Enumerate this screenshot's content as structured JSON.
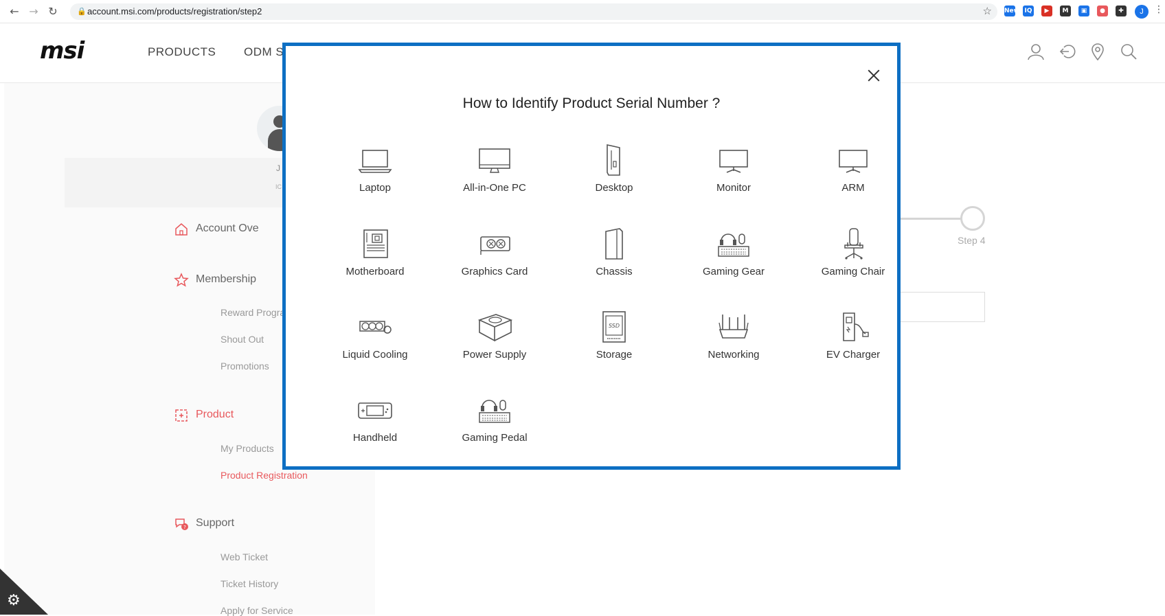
{
  "browser": {
    "url": "account.msi.com/products/registration/step2",
    "profile_initial": "J",
    "extensions": [
      {
        "name": "new-badge-extension",
        "label": "New",
        "color": "#1a73e8"
      },
      {
        "name": "iq-extension",
        "label": "IQ",
        "color": "#1a73e8"
      },
      {
        "name": "red-play-extension",
        "label": "▶",
        "color": "#d93025"
      },
      {
        "name": "m-extension",
        "label": "M",
        "color": "#333333"
      },
      {
        "name": "blue-square-extension",
        "label": "▣",
        "color": "#1a73e8"
      },
      {
        "name": "cake-extension",
        "label": "●",
        "color": "#e8585c"
      },
      {
        "name": "puzzle-extension",
        "label": "✚",
        "color": "#333333"
      }
    ]
  },
  "header": {
    "logo": "msi",
    "nav": [
      "PRODUCTS",
      "ODM SC"
    ]
  },
  "sidebar": {
    "user_initial": "J",
    "user_sub": "IC",
    "sections": [
      {
        "label": "Account Ove",
        "items": []
      },
      {
        "label": "Membership",
        "items": [
          "Reward Progra",
          "Shout Out",
          "Promotions"
        ]
      },
      {
        "label": "Product",
        "items": [
          "My Products",
          "Product Registration"
        ]
      },
      {
        "label": "Support",
        "items": [
          "Web Ticket",
          "Ticket History",
          "Apply for Service"
        ]
      }
    ]
  },
  "steps": {
    "step4_label": "Step 4"
  },
  "modal": {
    "title": "How to Identify Product Serial Number ?",
    "categories": [
      {
        "label": "Laptop",
        "icon": "laptop-icon"
      },
      {
        "label": "All-in-One PC",
        "icon": "all-in-one-pc-icon"
      },
      {
        "label": "Desktop",
        "icon": "desktop-icon"
      },
      {
        "label": "Monitor",
        "icon": "monitor-icon"
      },
      {
        "label": "ARM",
        "icon": "arm-icon"
      },
      {
        "label": "Motherboard",
        "icon": "motherboard-icon"
      },
      {
        "label": "Graphics Card",
        "icon": "graphics-card-icon"
      },
      {
        "label": "Chassis",
        "icon": "chassis-icon"
      },
      {
        "label": "Gaming Gear",
        "icon": "gaming-gear-icon"
      },
      {
        "label": "Gaming Chair",
        "icon": "gaming-chair-icon"
      },
      {
        "label": "Liquid Cooling",
        "icon": "liquid-cooling-icon"
      },
      {
        "label": "Power Supply",
        "icon": "power-supply-icon"
      },
      {
        "label": "Storage",
        "icon": "storage-icon",
        "icon_text": "SSD"
      },
      {
        "label": "Networking",
        "icon": "networking-icon"
      },
      {
        "label": "EV Charger",
        "icon": "ev-charger-icon"
      },
      {
        "label": "Handheld",
        "icon": "handheld-icon"
      },
      {
        "label": "Gaming Pedal",
        "icon": "gaming-pedal-icon"
      }
    ]
  },
  "colors": {
    "accent": "#e8585c",
    "modal_border": "#0d6fc3"
  }
}
